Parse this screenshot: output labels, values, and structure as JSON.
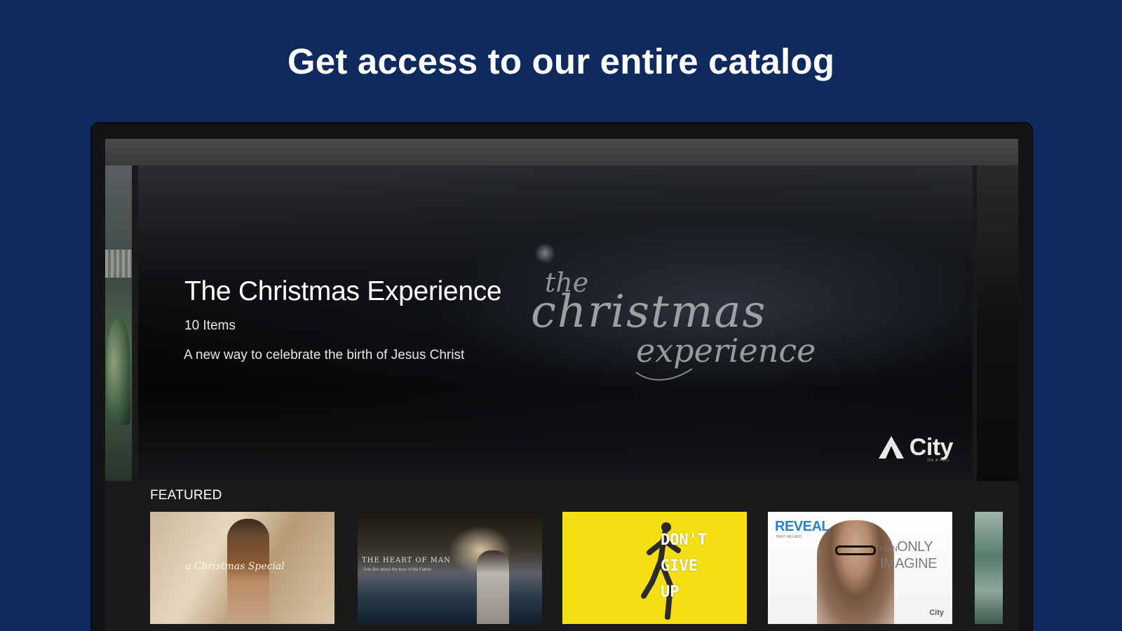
{
  "headline": "Get access to our entire catalog",
  "hero": {
    "title": "The Christmas Experience",
    "item_count": "10 Items",
    "description": "A new way to celebrate the birth of Jesus Christ",
    "script_line1": "the",
    "script_line2": "christmas",
    "script_line3": "experience",
    "logo_text": "City",
    "logo_sub": "ON A HILL",
    "logo_icon": "triangle-logo-icon"
  },
  "featured": {
    "label": "FEATURED",
    "items": [
      {
        "name": "christmas-special",
        "text": "a Christmas Special"
      },
      {
        "name": "heart-of-man",
        "text": "THE HEART OF MAN",
        "subtext": "One film about the love of the Father"
      },
      {
        "name": "dont-give-up",
        "text": "DON'T\nGIVE\nUP"
      },
      {
        "name": "i-can-only-imagine",
        "reveal": "REVEAL",
        "reveal_sub": "BART MILLARD",
        "ican": "I CAN",
        "imagine": "ONLY\nIMAGINE",
        "logo": "City"
      },
      {
        "name": "partial-next",
        "text": ""
      }
    ]
  },
  "colors": {
    "page_background": "#0e2a5e",
    "thumb_yellow": "#f4df14",
    "reveal_blue": "#2a7fc8"
  }
}
